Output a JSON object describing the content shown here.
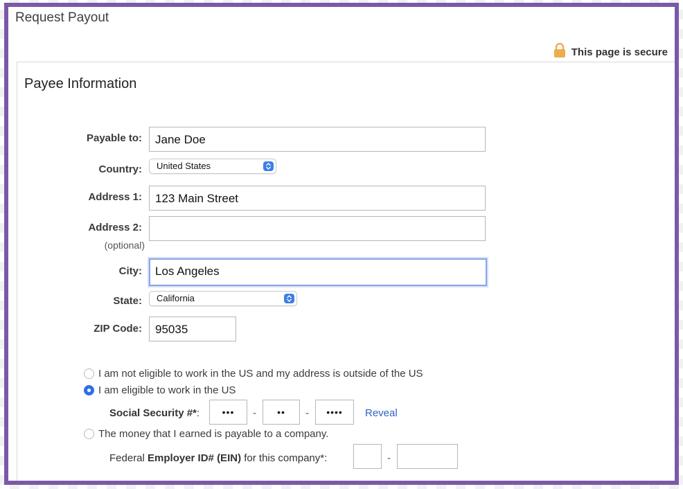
{
  "page": {
    "title": "Request Payout",
    "secure_text": "This page is secure"
  },
  "section": {
    "title": "Payee Information"
  },
  "form": {
    "payable_to": {
      "label": "Payable to:",
      "value": "Jane Doe"
    },
    "country": {
      "label": "Country:",
      "value": "United States"
    },
    "address1": {
      "label": "Address 1:",
      "value": "123 Main Street"
    },
    "address2": {
      "label": "Address 2:",
      "sublabel": "(optional)",
      "value": ""
    },
    "city": {
      "label": "City:",
      "value": "Los Angeles"
    },
    "state": {
      "label": "State:",
      "value": "California"
    },
    "zip": {
      "label": "ZIP Code:",
      "value": "95035"
    }
  },
  "eligibility": {
    "options": [
      {
        "label": "I am not eligible to work in the US and my address is outside of the US",
        "checked": false
      },
      {
        "label": "I am eligible to work in the US",
        "checked": true
      },
      {
        "label": "The money that I earned is payable to a company.",
        "checked": false
      }
    ],
    "ssn": {
      "label_bold": "Social Security #*",
      "label_tail": ":",
      "part1": "•••",
      "part2": "••",
      "part3": "••••",
      "separator": "-",
      "reveal": "Reveal"
    },
    "ein": {
      "label_prefix": "Federal ",
      "label_bold": "Employer ID# (EIN)",
      "label_suffix": " for this company*:",
      "part1": "",
      "part2": "",
      "separator": "-"
    }
  },
  "colors": {
    "frame": "#7a5aa6",
    "accent": "#2f6fe6",
    "lock": "#e9ae4f",
    "link": "#2b5fc4"
  }
}
